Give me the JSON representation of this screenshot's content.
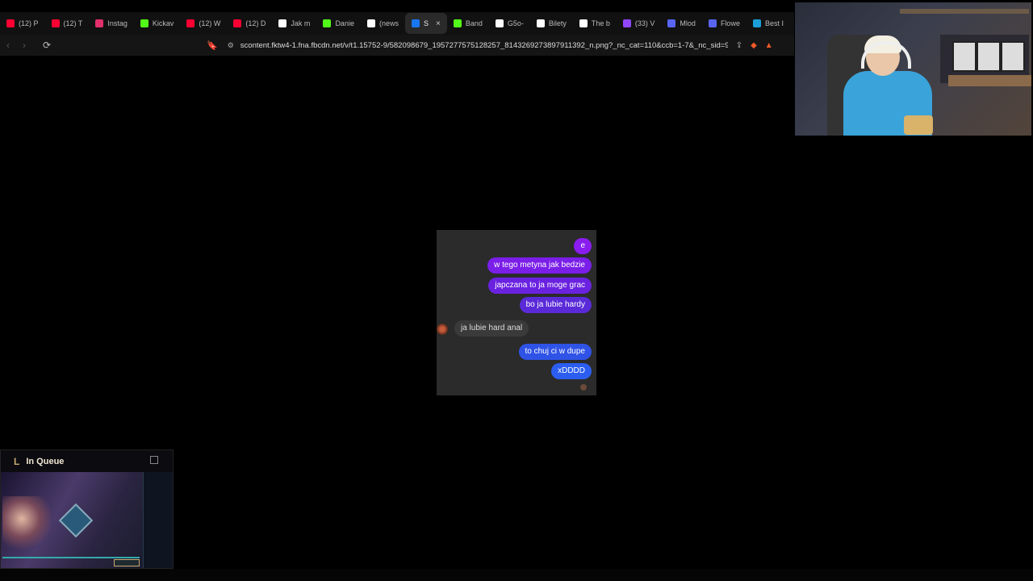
{
  "browser": {
    "tabs": [
      {
        "label": "(12) P",
        "icon": "youtube-icon",
        "color": "#ff0033"
      },
      {
        "label": "(12) T",
        "icon": "youtube-icon",
        "color": "#ff0033"
      },
      {
        "label": "Instag",
        "icon": "instagram-icon",
        "color": "#e1306c"
      },
      {
        "label": "Kickav",
        "icon": "kick-icon",
        "color": "#53fc18"
      },
      {
        "label": "(12) W",
        "icon": "youtube-icon",
        "color": "#ff0033"
      },
      {
        "label": "(12) D",
        "icon": "youtube-icon",
        "color": "#ff0033"
      },
      {
        "label": "Jak m",
        "icon": "tiktok-icon",
        "color": "#ffffff"
      },
      {
        "label": "Danie",
        "icon": "kick-icon",
        "color": "#53fc18"
      },
      {
        "label": "(news",
        "icon": "x-icon",
        "color": "#ffffff"
      },
      {
        "label": "S",
        "icon": "facebook-icon",
        "color": "#1877f2",
        "active": true
      },
      {
        "label": "Band",
        "icon": "kick-icon",
        "color": "#53fc18"
      },
      {
        "label": "G5o-",
        "icon": "x-icon",
        "color": "#ffffff"
      },
      {
        "label": "Bilety",
        "icon": "b-icon",
        "color": "#ffffff"
      },
      {
        "label": "The b",
        "icon": "diamond-icon",
        "color": "#ffffff"
      },
      {
        "label": "(33) V",
        "icon": "twitch-icon",
        "color": "#9146ff"
      },
      {
        "label": "Mlod",
        "icon": "app-icon",
        "color": "#5865f2"
      },
      {
        "label": "Flowe",
        "icon": "app-icon",
        "color": "#5865f2"
      },
      {
        "label": "Best I",
        "icon": "l-icon",
        "color": "#1a9fd9"
      }
    ],
    "url": "scontent.fktw4-1.fna.fbcdn.net/v/t1.15752-9/582098679_1957277575128257_8143269273897911392_n.png?_nc_cat=110&ccb=1-7&_nc_sid=9f807c..."
  },
  "chat": {
    "messages": [
      {
        "text": "e",
        "dir": "out",
        "color": "#8a1cf0"
      },
      {
        "text": "w tego metyna jak bedzie",
        "dir": "out",
        "color": "#7a1ee8"
      },
      {
        "text": "japczana to ja moge grac",
        "dir": "out",
        "color": "#6b22e0"
      },
      {
        "text": "bo ja lubie hardy",
        "dir": "out",
        "color": "#5a2ad8"
      },
      {
        "text": "ja lubie hard anal",
        "dir": "in",
        "color": "#3a3a3a"
      },
      {
        "text": "to chuj ci w dupe",
        "dir": "out",
        "color": "#2f53e6"
      },
      {
        "text": "xDDDD",
        "dir": "out",
        "color": "#2b5ef0"
      }
    ]
  },
  "lol_client": {
    "title": "In Queue"
  }
}
